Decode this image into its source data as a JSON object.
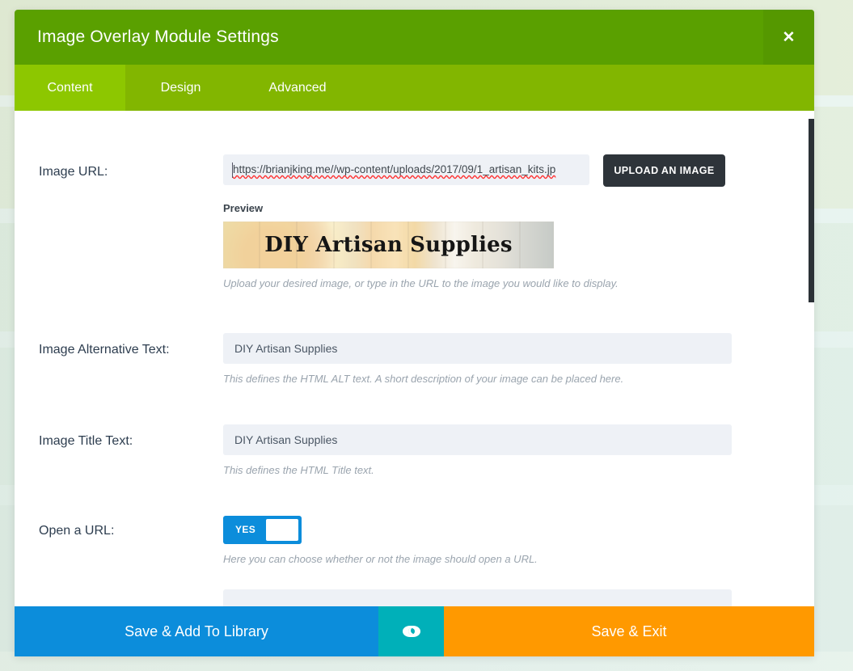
{
  "modal": {
    "title": "Image Overlay Module Settings",
    "close_icon": "close-icon",
    "close_glyph": "✕"
  },
  "tabs": [
    {
      "label": "Content",
      "active": true
    },
    {
      "label": "Design",
      "active": false
    },
    {
      "label": "Advanced",
      "active": false
    }
  ],
  "fields": {
    "image_url": {
      "label": "Image URL:",
      "value": "https://brianjking.me//wp-content/uploads/2017/09/1_artisan_kits.jp",
      "upload_button": "UPLOAD AN IMAGE",
      "preview_label": "Preview",
      "preview_caption": "DIY Artisan Supplies",
      "help": "Upload your desired image, or type in the URL to the image you would like to display."
    },
    "alt_text": {
      "label": "Image Alternative Text:",
      "value": "DIY Artisan Supplies",
      "help": "This defines the HTML ALT text. A short description of your image can be placed here."
    },
    "title_text": {
      "label": "Image Title Text:",
      "value": "DIY Artisan Supplies",
      "help": "This defines the HTML Title text."
    },
    "open_url": {
      "label": "Open a URL:",
      "toggle_value": "YES",
      "help": "Here you can choose whether or not the image should open a URL."
    }
  },
  "footer": {
    "save_library_label": "Save & Add To Library",
    "preview_icon": "eye-icon",
    "save_exit_label": "Save & Exit"
  },
  "colors": {
    "header_green": "#5aa000",
    "tab_bar_green": "#82b600",
    "tab_active_green": "#8dc700",
    "blue": "#0c8ddb",
    "teal": "#00b0b9",
    "orange": "#ff9900",
    "dark": "#2e343a"
  }
}
